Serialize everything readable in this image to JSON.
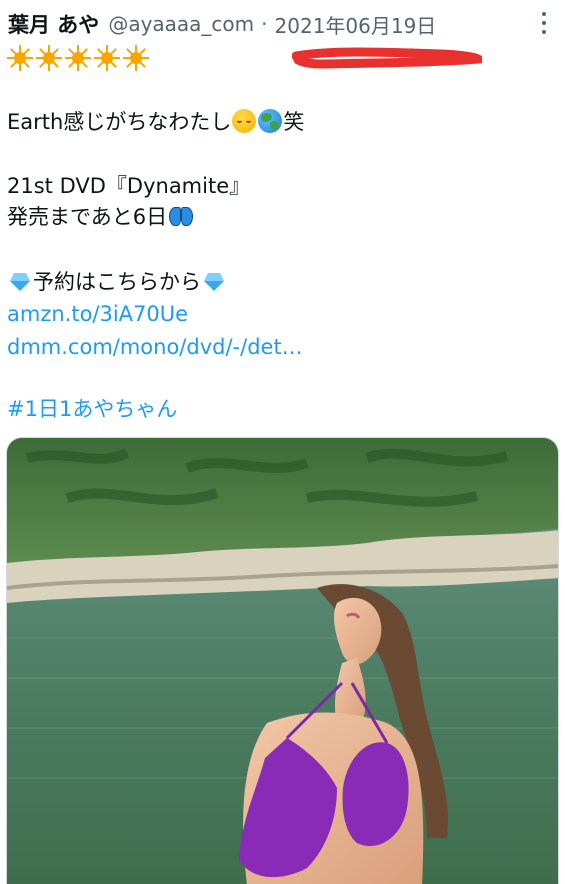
{
  "tweet": {
    "display_name": "葉月 あや",
    "handle": "@ayaaaa_com",
    "separator": "·",
    "date": "2021年06月19日",
    "lines": {
      "line1_text": "Earth感じがちなわたし",
      "line1_tail": "笑",
      "line2": "21st DVD『Dynamite』",
      "line3_text": "発売まであと6日",
      "line4_text": "予約はこちらから"
    },
    "links": {
      "amazon": "amzn.to/3iA70Ue",
      "dmm": "dmm.com/mono/dvd/-/det…",
      "hashtag": "#1日1あやちゃん"
    },
    "icons": [
      "more-icon",
      "sun-emoji",
      "relieved-face-emoji",
      "globe-emoji",
      "butterfly-emoji",
      "gem-emoji"
    ]
  },
  "colors": {
    "text": "#0f1419",
    "secondary": "#536471",
    "link": "#1d9bf0",
    "redaction_scribble": "#e8312f"
  }
}
